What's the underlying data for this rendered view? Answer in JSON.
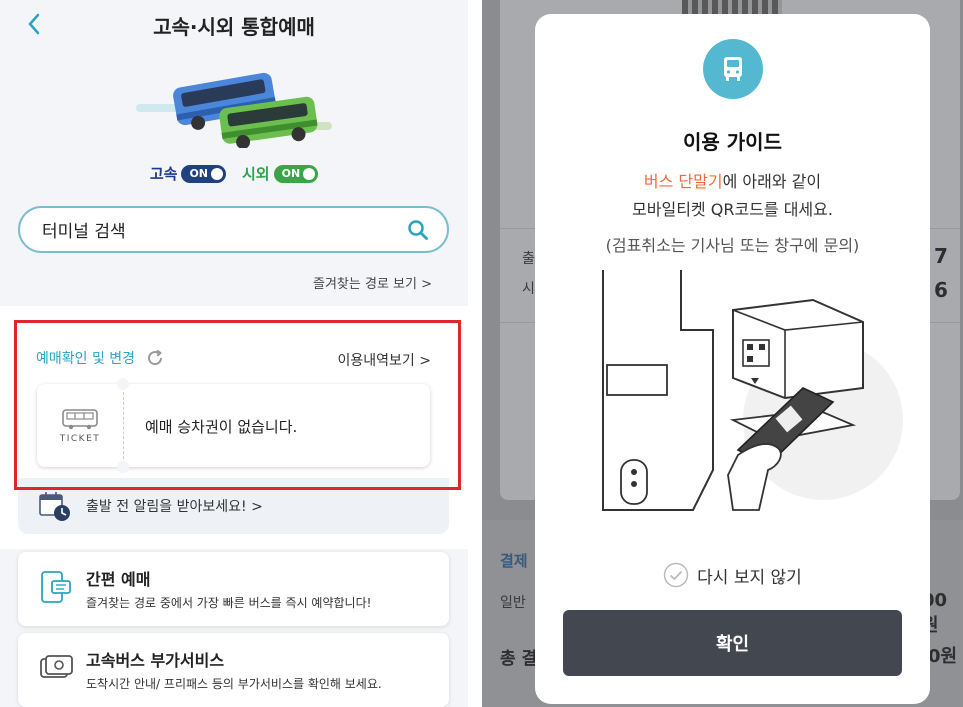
{
  "left_screen": {
    "header": {
      "back_icon": "chevron-left-icon",
      "title": "고속·시외 통합예매"
    },
    "toggles": {
      "express_label": "고속",
      "express_state": "ON",
      "intercity_label": "시외",
      "intercity_state": "ON"
    },
    "search": {
      "placeholder": "터미널 검색",
      "icon": "search-icon"
    },
    "favorites_link": "즐겨찾는 경로 보기 >",
    "reservation": {
      "title": "예매확인 및 변경",
      "history_link": "이용내역보기 >",
      "ticket_label": "TICKET",
      "empty_message": "예매 승차권이 없습니다."
    },
    "alert_text": "출발 전 알림을 받아보세요! >",
    "services": [
      {
        "title": "간편 예매",
        "desc": "즐겨찾는 경로 중에서 가장 빠른 버스를 즉시 예약합니다!",
        "icon": "mobile-ticket-icon"
      },
      {
        "title": "고속버스 부가서비스",
        "desc": "도착시간 안내/ 프리패스 등의 부가서비스를 확인해 보세요.",
        "icon": "card-service-icon"
      }
    ],
    "colors": {
      "accent": "#2aa4be",
      "highlight_border": "#e0262b",
      "express_pill": "#20417f",
      "intercity_pill": "#3aa447"
    }
  },
  "right_screen": {
    "background": {
      "row_labels": [
        "출",
        "시"
      ],
      "row_values": [
        "7",
        "6"
      ],
      "section_label": "결제",
      "fare_label": "일반",
      "fare_value": "00원",
      "total_label": "총 결",
      "total_value": "0원"
    },
    "modal": {
      "icon": "bus-icon",
      "title": "이용 가이드",
      "line1_accent": "버스 단말기",
      "line1_rest": "에 아래와 같이",
      "line2": "모바일티켓 QR코드를 대세요.",
      "line3": "(검표취소는 기사님 또는 창구에 문의)",
      "dont_show_label": "다시 보지 않기",
      "confirm_label": "확인"
    },
    "colors": {
      "accent_orange": "#f06a3c",
      "icon_bg": "#54b9d0",
      "button_bg": "#424750"
    }
  }
}
